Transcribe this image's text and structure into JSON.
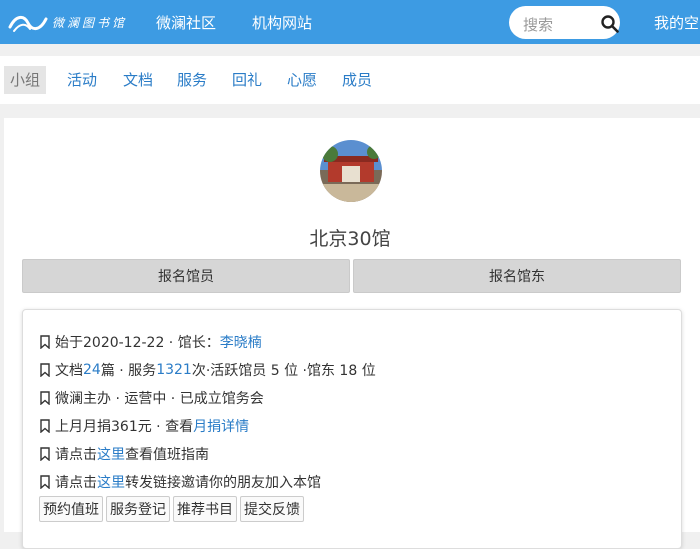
{
  "header": {
    "logo_text": "微澜图书馆",
    "nav": [
      "微澜社区",
      "机构网站"
    ],
    "search_placeholder": "搜索",
    "my_space": "我的空"
  },
  "tabs": [
    "小组",
    "活动",
    "文档",
    "服务",
    "回礼",
    "心愿",
    "成员"
  ],
  "group": {
    "name": "北京30馆",
    "join_buttons": [
      "报名馆员",
      "报名馆东"
    ]
  },
  "info": {
    "line1": {
      "prefix": "始于2020-12-22 · 馆长：",
      "manager": "李晓楠"
    },
    "line2": {
      "p1": "文档 ",
      "docs": "24",
      "p2": " 篇 · 服务 ",
      "services": "1321",
      "p3": " 次·活跃馆员 5 位 ·馆东 18 位"
    },
    "line3": "微澜主办 · 运营中  · 已成立馆务会",
    "line4": {
      "prefix": "上月月捐361元 · 查看",
      "link": "月捐详情"
    },
    "line5": {
      "prefix": "请点击",
      "link": "这里",
      "suffix": "查看值班指南"
    },
    "line6": {
      "prefix": "请点击",
      "link": "这里",
      "suffix": "转发链接邀请你的朋友加入本馆"
    },
    "actions": [
      "预约值班",
      "服务登记",
      "推荐书目",
      "提交反馈"
    ]
  },
  "colors": {
    "brand": "#3d9be3",
    "link": "#2a7cc7",
    "button_gray": "#d6d6d6"
  }
}
